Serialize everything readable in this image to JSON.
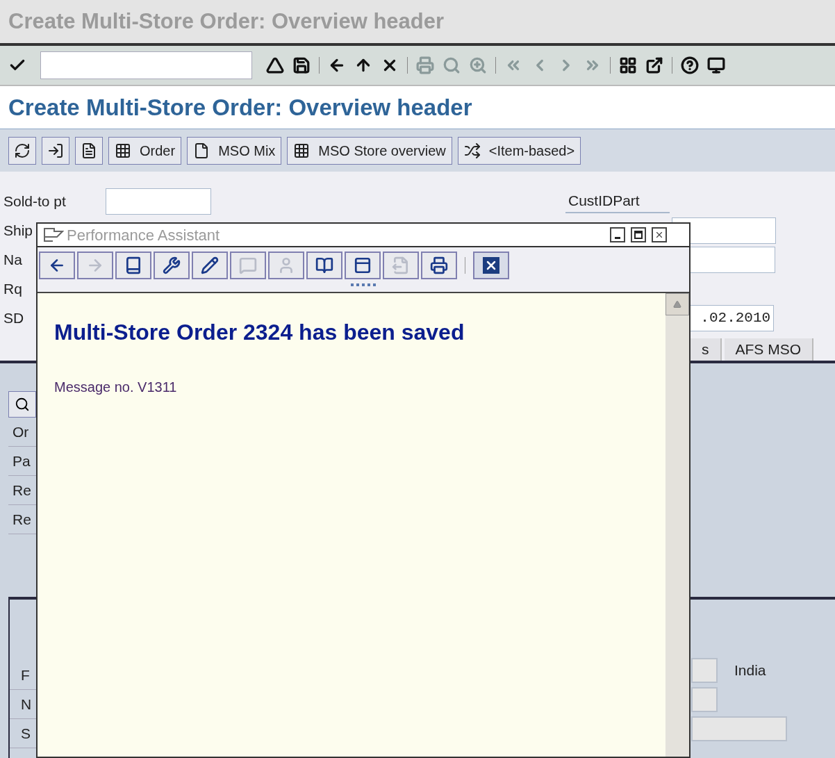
{
  "window_title": "Create Multi-Store Order: Overview header",
  "toolbar_icons": [
    {
      "kind": "enter",
      "disabled": false
    },
    {
      "kind": "field"
    },
    {
      "kind": "back-small",
      "disabled": false
    },
    {
      "kind": "save",
      "disabled": false
    },
    {
      "kind": "sep"
    },
    {
      "kind": "back",
      "disabled": false
    },
    {
      "kind": "exit",
      "disabled": false
    },
    {
      "kind": "cancel",
      "disabled": false
    },
    {
      "kind": "sep"
    },
    {
      "kind": "print",
      "disabled": true
    },
    {
      "kind": "find",
      "disabled": true
    },
    {
      "kind": "find-next",
      "disabled": true
    },
    {
      "kind": "sep"
    },
    {
      "kind": "first",
      "disabled": true
    },
    {
      "kind": "prev",
      "disabled": true
    },
    {
      "kind": "next",
      "disabled": true
    },
    {
      "kind": "last",
      "disabled": true
    },
    {
      "kind": "sep"
    },
    {
      "kind": "layout",
      "disabled": false
    },
    {
      "kind": "shortcut",
      "disabled": false
    },
    {
      "kind": "sep"
    },
    {
      "kind": "help",
      "disabled": false
    },
    {
      "kind": "monitor",
      "disabled": false
    }
  ],
  "screen_title": "Create Multi-Store Order: Overview header",
  "app_toolbar": [
    {
      "kind": "refresh"
    },
    {
      "kind": "import"
    },
    {
      "kind": "detail"
    },
    {
      "kind": "grid",
      "label": "Order"
    },
    {
      "kind": "page",
      "label": "MSO Mix"
    },
    {
      "kind": "grid",
      "label": "MSO Store overview"
    },
    {
      "kind": "switch",
      "label": "<Item-based>"
    }
  ],
  "header_fields": [
    {
      "label": "Sold-to pt"
    },
    {
      "label": "Ship"
    },
    {
      "label": "Na"
    },
    {
      "label": "Rq"
    },
    {
      "label": "SD"
    }
  ],
  "right_fields": {
    "label": "CustIDPart",
    "date_value": ".02.2010"
  },
  "tabs": [
    {
      "label": "s",
      "selected": false
    },
    {
      "label": "AFS MSO",
      "selected": false
    }
  ],
  "panel_labels": [
    "Or",
    "Pa",
    "Re",
    "Re"
  ],
  "lower_labels": [
    "F",
    "N",
    "S"
  ],
  "country": "India",
  "popup": {
    "title": "Performance Assistant",
    "tools": [
      {
        "kind": "back",
        "disabled": false
      },
      {
        "kind": "forward",
        "disabled": true
      },
      {
        "kind": "book",
        "disabled": false
      },
      {
        "kind": "tools",
        "disabled": false
      },
      {
        "kind": "edit",
        "disabled": false
      },
      {
        "kind": "note",
        "disabled": true
      },
      {
        "kind": "person",
        "disabled": true
      },
      {
        "kind": "open-book",
        "disabled": false
      },
      {
        "kind": "panel",
        "disabled": false
      },
      {
        "kind": "print-out",
        "disabled": true
      },
      {
        "kind": "print",
        "disabled": false
      },
      {
        "kind": "close",
        "disabled": false
      }
    ],
    "heading": "Multi-Store Order 2324 has been saved",
    "message": "Message no. V1311"
  }
}
